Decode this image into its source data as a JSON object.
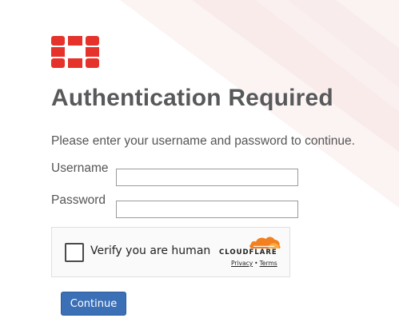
{
  "page": {
    "title": "Authentication Required",
    "instructions": "Please enter your username and password to continue."
  },
  "form": {
    "username_label": "Username",
    "username_value": "",
    "password_label": "Password",
    "password_value": "",
    "submit_label": "Continue"
  },
  "captcha": {
    "checkbox_label": "Verify you are human",
    "checked": false,
    "brand": "CLOUDFLARE",
    "privacy_label": "Privacy",
    "separator": "•",
    "terms_label": "Terms"
  },
  "icons": {
    "logo": "fortinet-logo-icon",
    "captcha_brand": "cloudflare-cloud-icon"
  },
  "colors": {
    "logo_red": "#e5322b",
    "title_gray": "#58595b",
    "button_blue": "#3b6fb6",
    "cloudflare_orange": "#f38020"
  }
}
